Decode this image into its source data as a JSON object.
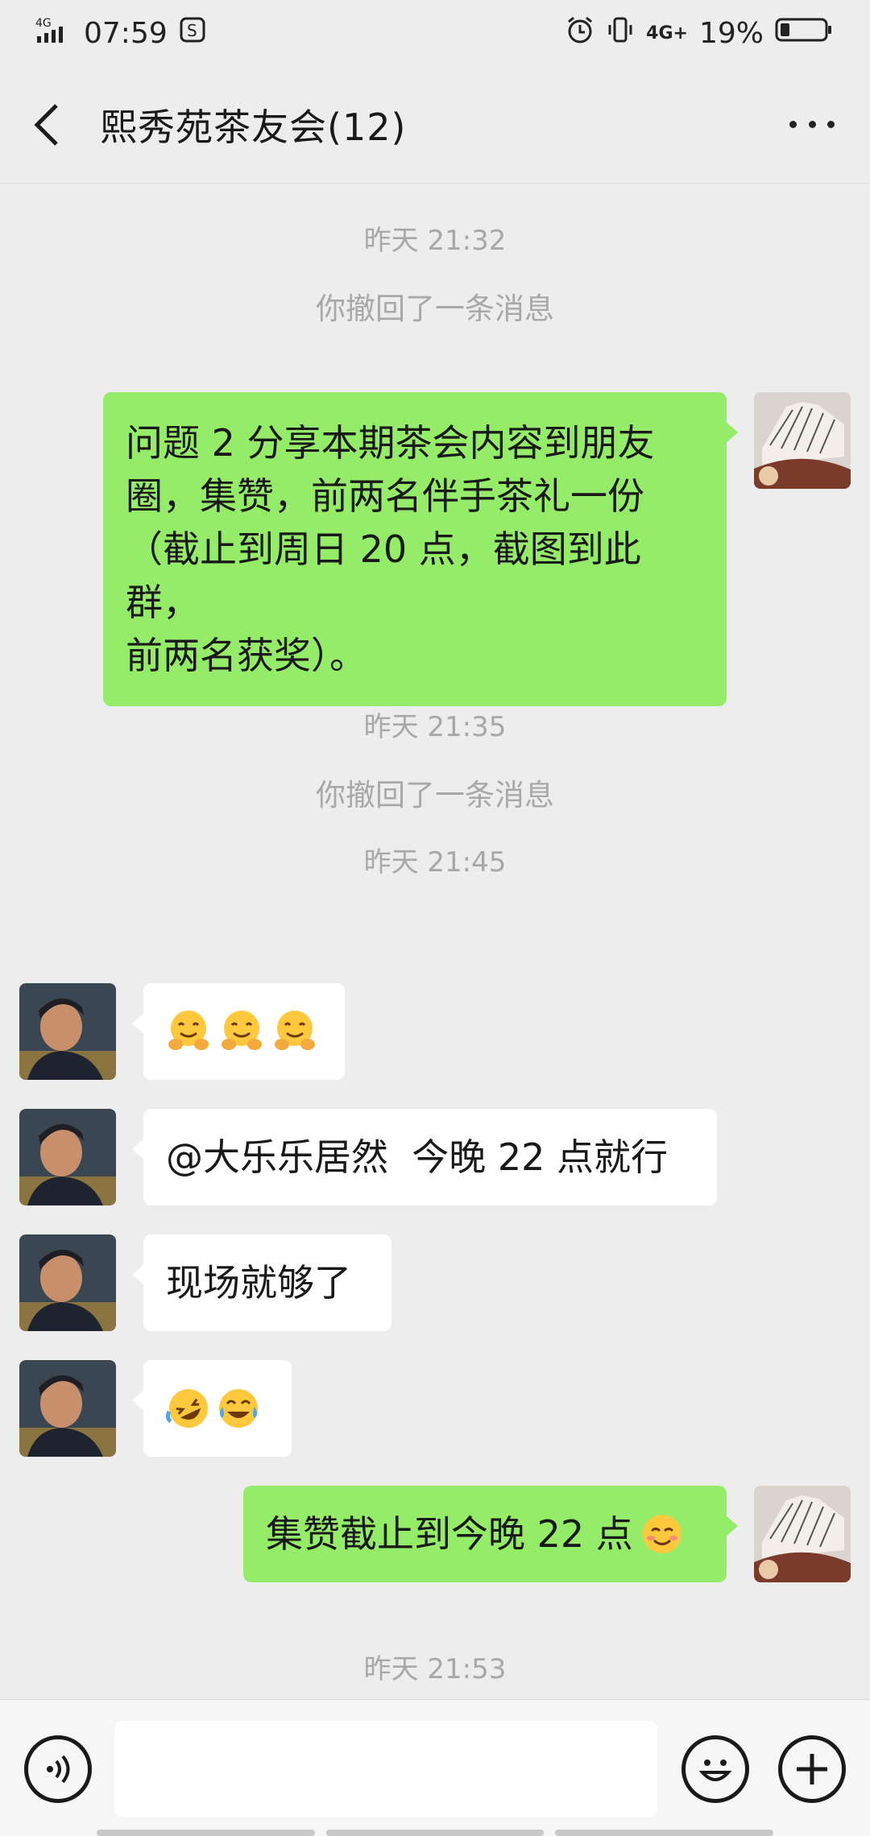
{
  "status_bar": {
    "network_left": "4G",
    "time": "07:59",
    "network_right": "4G+",
    "battery": "19%"
  },
  "header": {
    "title": "熙秀苑茶友会(12)"
  },
  "messages": [
    {
      "type": "time",
      "text": "昨天 21:32"
    },
    {
      "type": "system",
      "text": "你撤回了一条消息"
    },
    {
      "type": "me",
      "lines": [
        "问题 2 分享本期茶会内容到朋友",
        "圈，集赞，前两名伴手茶礼一份",
        "（截止到周日 20 点，截图到此群，",
        "前两名获奖）。"
      ]
    },
    {
      "type": "time",
      "text": "昨天 21:35"
    },
    {
      "type": "system",
      "text": "你撤回了一条消息"
    },
    {
      "type": "time",
      "text": "昨天 21:45"
    },
    {
      "type": "other",
      "emoji": [
        "hugging-face",
        "hugging-face",
        "hugging-face"
      ]
    },
    {
      "type": "other",
      "text": "@大乐乐居然  今晚 22 点就行"
    },
    {
      "type": "other",
      "text": "现场就够了"
    },
    {
      "type": "other",
      "emoji": [
        "rolling-laughing-face",
        "tears-of-joy-face"
      ]
    },
    {
      "type": "me",
      "text": "集赞截止到今晚 22 点"
    },
    {
      "type": "time",
      "text": "昨天 21:53"
    }
  ],
  "input": {
    "placeholder": ""
  },
  "colors": {
    "background": "#EDEDED",
    "my_bubble": "#95EC69",
    "other_bubble": "#FFFFFF",
    "system_text": "#A8A8A8"
  }
}
